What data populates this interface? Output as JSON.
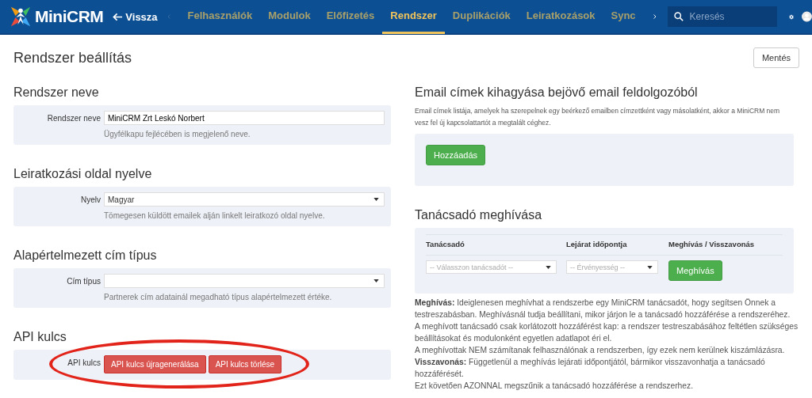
{
  "header": {
    "logo": "MiniCRM",
    "back": "Vissza",
    "tabs": [
      {
        "label": "Felhasználók",
        "selected": false
      },
      {
        "label": "Modulok",
        "selected": false
      },
      {
        "label": "Előfizetés",
        "selected": false
      },
      {
        "label": "Rendszer",
        "selected": true
      },
      {
        "label": "Duplikációk",
        "selected": false
      },
      {
        "label": "Leiratkozások",
        "selected": false
      },
      {
        "label": "Sync",
        "selected": false
      }
    ],
    "search": {
      "placeholder": "Keresés"
    }
  },
  "page": {
    "title": "Rendszer beállítás",
    "save": "Mentés"
  },
  "left_sections": [
    {
      "heading": "Rendszer neve",
      "kind": "text",
      "label": "Rendszer neve",
      "value": "MiniCRM Zrt Leskó Norbert",
      "help": "Ügyfélkapu fejlécében is megjelenő neve."
    },
    {
      "heading": "Leiratkozási oldal nyelve",
      "kind": "select",
      "label": "Nyelv",
      "value": "Magyar",
      "help": "Tömegesen küldött emailek alján linkelt leiratkozó oldal nyelve."
    },
    {
      "heading": "Alapértelmezett cím típus",
      "kind": "select",
      "label": "Cím típus",
      "help": "Partnerek cím adatainál megadható típus alapértelmezett értéke."
    },
    {
      "heading": "API kulcs",
      "kind": "buttons",
      "label": "API kulcs",
      "highlighted": true,
      "buttons": [
        "API kulcs újragenerálása",
        "API kulcs törlése"
      ]
    }
  ],
  "email_skip": {
    "heading": "Email címek kihagyása bejövő email feldolgozóból",
    "description": "Email címek listája, amelyek ha szerepelnek egy beérkező emailben címzettként vagy másolatként, akkor a MiniCRM nem vesz fel új kapcsolattartót a megtalált céghez.",
    "add": "Hozzáadás"
  },
  "advisor": {
    "heading": "Tanácsadó meghívása",
    "columns": [
      "Tanácsadó",
      "Lejárat időpontja",
      "Meghívás / Visszavonás"
    ],
    "advisor_select": {
      "placeholder": "-- Válasszon tanácsadót --"
    },
    "expiry_select": {
      "placeholder": "-- Érvényesség --"
    },
    "invite": "Meghívás",
    "notes": [
      "**Meghívás:** Ideiglenesen meghívhat a rendszerbe egy MiniCRM tanácsadót, hogy segítsen Önnek a testreszabásban. Meghívásnál tudja beállítani, mikor járjon le a tanácsadó hozzáférése a rendszeréhez.",
      "A meghívott tanácsadó csak korlátozott hozzáférést kap: a rendszer testreszabásához feltétlen szükséges beállításokat és modulonként egyetlen adatlapot éri el.",
      "A meghívottak NEM számítanak felhasználónak a rendszerben, így ezek nem kerülnek kiszámlázásra.",
      "**Visszavonás:** Függetlenül a meghívás lejárati időpontjától, bármikor visszavonhatja a tanácsadó hozzáférését.",
      "Ezt követően AZONNAL megszűnik a tanácsadó hozzáférése a rendszerhez."
    ]
  }
}
